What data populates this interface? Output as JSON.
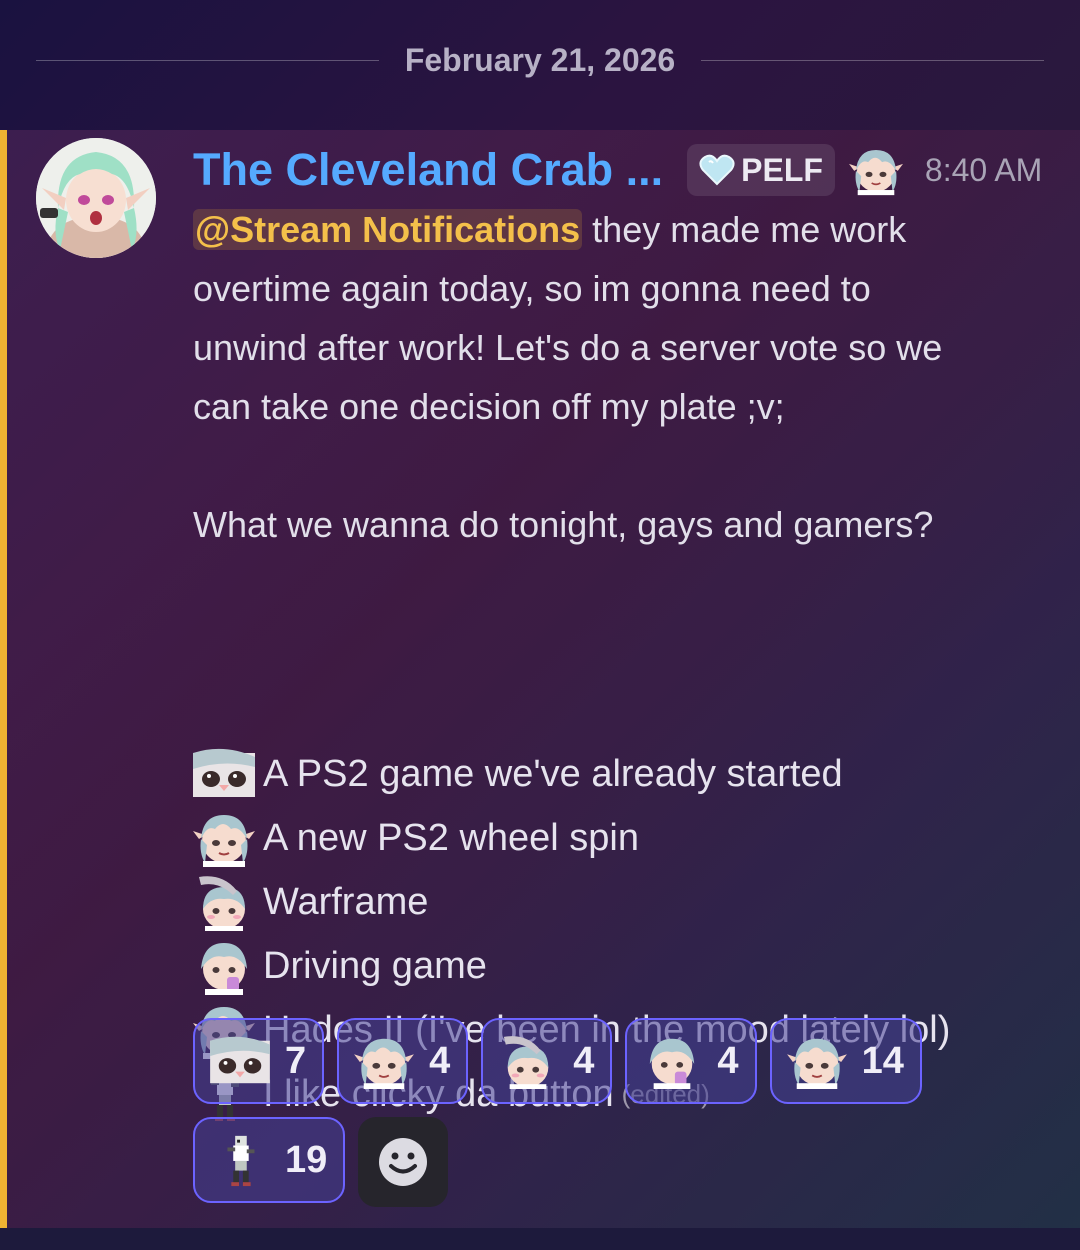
{
  "date_divider": "February 21, 2026",
  "message": {
    "author": "The Cleveland Crab ...",
    "tag": {
      "icon": "heart-icon",
      "label": "PELF"
    },
    "role_icon": "elf-emoji-icon",
    "timestamp": "8:40 AM",
    "mention": "@Stream Notifications",
    "lines": [
      " they made me work",
      "overtime again today, so im gonna need to",
      "unwind after work! Let's do a server vote so we",
      "can take one decision off my plate ;v;",
      "",
      "What we wanna do tonight, gays and gamers?"
    ],
    "options": [
      {
        "emoji": "closeup-face-emoji",
        "text": "A PS2 game we've already started"
      },
      {
        "emoji": "smug-elf-emoji",
        "text": "A new PS2 wheel spin"
      },
      {
        "emoji": "pat-elf-emoji",
        "text": "Warframe"
      },
      {
        "emoji": "sip-elf-emoji",
        "text": "Driving game"
      },
      {
        "emoji": "smile-elf-emoji",
        "text": "Hades II (I've been in the mood lately lol)"
      },
      {
        "emoji": "pixel-sprite-emoji",
        "text": "I like clicky da button",
        "edited": "(edited)"
      }
    ],
    "reactions": [
      {
        "emoji": "closeup-face-emoji",
        "count": "7"
      },
      {
        "emoji": "smug-elf-emoji",
        "count": "4"
      },
      {
        "emoji": "pat-elf-emoji",
        "count": "4"
      },
      {
        "emoji": "sip-elf-emoji",
        "count": "4"
      },
      {
        "emoji": "smile-elf-emoji",
        "count": "14"
      },
      {
        "emoji": "pixel-sprite-emoji",
        "count": "19"
      }
    ],
    "add_reaction_icon": "add-reaction-smiley-icon"
  },
  "colors": {
    "username": "#55aaff",
    "mention": "#f4c04a",
    "accent_bar": "#f0b232",
    "reaction_border": "#6c63ff"
  }
}
